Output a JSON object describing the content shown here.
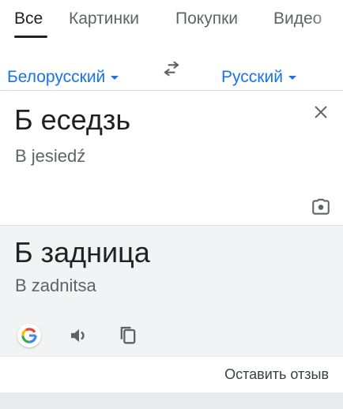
{
  "tabs": [
    {
      "label": "Все",
      "active": true
    },
    {
      "label": "Картинки",
      "active": false
    },
    {
      "label": "Покупки",
      "active": false
    },
    {
      "label": "Видео",
      "active": false
    }
  ],
  "translator": {
    "source_language": "Белорусский",
    "target_language": "Русский",
    "source_text": "Б еседзь",
    "source_transliteration": "B jesiedź",
    "translated_text": "Б задница",
    "translated_transliteration": "B zadnitsa"
  },
  "feedback_label": "Оставить отзыв",
  "colors": {
    "accent": "#1a73e8",
    "result_bg": "#f1f3f4",
    "text": "#202124",
    "muted": "#5f6368"
  },
  "icons": [
    "swap-languages-icon",
    "clear-icon",
    "camera-icon",
    "google-g-icon",
    "speaker-icon",
    "copy-icon"
  ]
}
